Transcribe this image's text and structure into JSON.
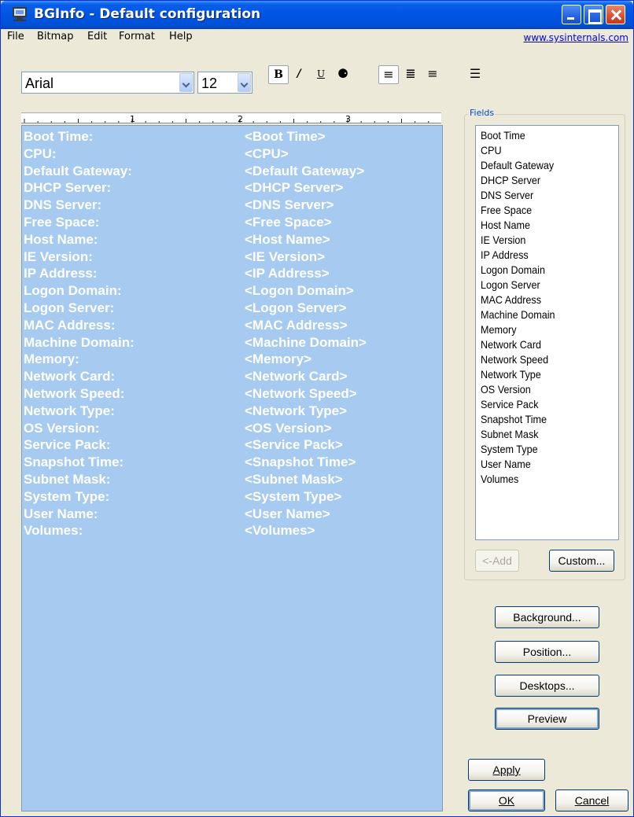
{
  "window": {
    "title": "BGInfo - Default configuration"
  },
  "menu": {
    "items": [
      "File",
      "Bitmap",
      "Edit",
      "Format",
      "Help"
    ],
    "link": "www.sysinternals.com"
  },
  "toolbar": {
    "font_name": "Arial",
    "font_size": "12",
    "bold_label": "B",
    "italic_label": "/",
    "underline_label": "U",
    "color_label": "⚈",
    "align_left_label": "≡",
    "align_center_label": "≣",
    "align_right_label": "≡",
    "bullets_label": "☰"
  },
  "ruler": {
    "marks": [
      "1",
      "2",
      "3"
    ]
  },
  "editor": {
    "background_color": "#A6CAF0",
    "text_color": "#FFFFFF",
    "rows": [
      {
        "label": "Boot Time:",
        "value": "<Boot Time>"
      },
      {
        "label": "CPU:",
        "value": "<CPU>"
      },
      {
        "label": "Default Gateway:",
        "value": "<Default Gateway>"
      },
      {
        "label": "DHCP Server:",
        "value": "<DHCP Server>"
      },
      {
        "label": "DNS Server:",
        "value": "<DNS Server>"
      },
      {
        "label": "Free Space:",
        "value": "<Free Space>"
      },
      {
        "label": "Host Name:",
        "value": "<Host Name>"
      },
      {
        "label": "IE Version:",
        "value": "<IE Version>"
      },
      {
        "label": "IP Address:",
        "value": "<IP Address>"
      },
      {
        "label": "Logon Domain:",
        "value": "<Logon Domain>"
      },
      {
        "label": "Logon Server:",
        "value": "<Logon Server>"
      },
      {
        "label": "MAC Address:",
        "value": "<MAC Address>"
      },
      {
        "label": "Machine Domain:",
        "value": "<Machine Domain>"
      },
      {
        "label": "Memory:",
        "value": "<Memory>"
      },
      {
        "label": "Network Card:",
        "value": "<Network Card>"
      },
      {
        "label": "Network Speed:",
        "value": "<Network Speed>"
      },
      {
        "label": "Network Type:",
        "value": "<Network Type>"
      },
      {
        "label": "OS Version:",
        "value": "<OS Version>"
      },
      {
        "label": "Service Pack:",
        "value": "<Service Pack>"
      },
      {
        "label": "Snapshot Time:",
        "value": "<Snapshot Time>"
      },
      {
        "label": "Subnet Mask:",
        "value": "<Subnet Mask>"
      },
      {
        "label": "System Type:",
        "value": "<System Type>"
      },
      {
        "label": "User Name:",
        "value": "<User Name>"
      },
      {
        "label": "Volumes:",
        "value": "<Volumes>"
      }
    ]
  },
  "fields": {
    "group_label": "Fields",
    "items": [
      "Boot Time",
      "CPU",
      "Default Gateway",
      "DHCP Server",
      "DNS Server",
      "Free Space",
      "Host Name",
      "IE Version",
      "IP Address",
      "Logon Domain",
      "Logon Server",
      "MAC Address",
      "Machine Domain",
      "Memory",
      "Network Card",
      "Network Speed",
      "Network Type",
      "OS Version",
      "Service Pack",
      "Snapshot Time",
      "Subnet Mask",
      "System Type",
      "User Name",
      "Volumes"
    ],
    "add_label": "<-Add",
    "custom_label": "Custom..."
  },
  "buttons": {
    "background": "Background...",
    "position": "Position...",
    "desktops": "Desktops...",
    "preview": "Preview",
    "apply": "Apply",
    "ok": "OK",
    "cancel": "Cancel"
  }
}
